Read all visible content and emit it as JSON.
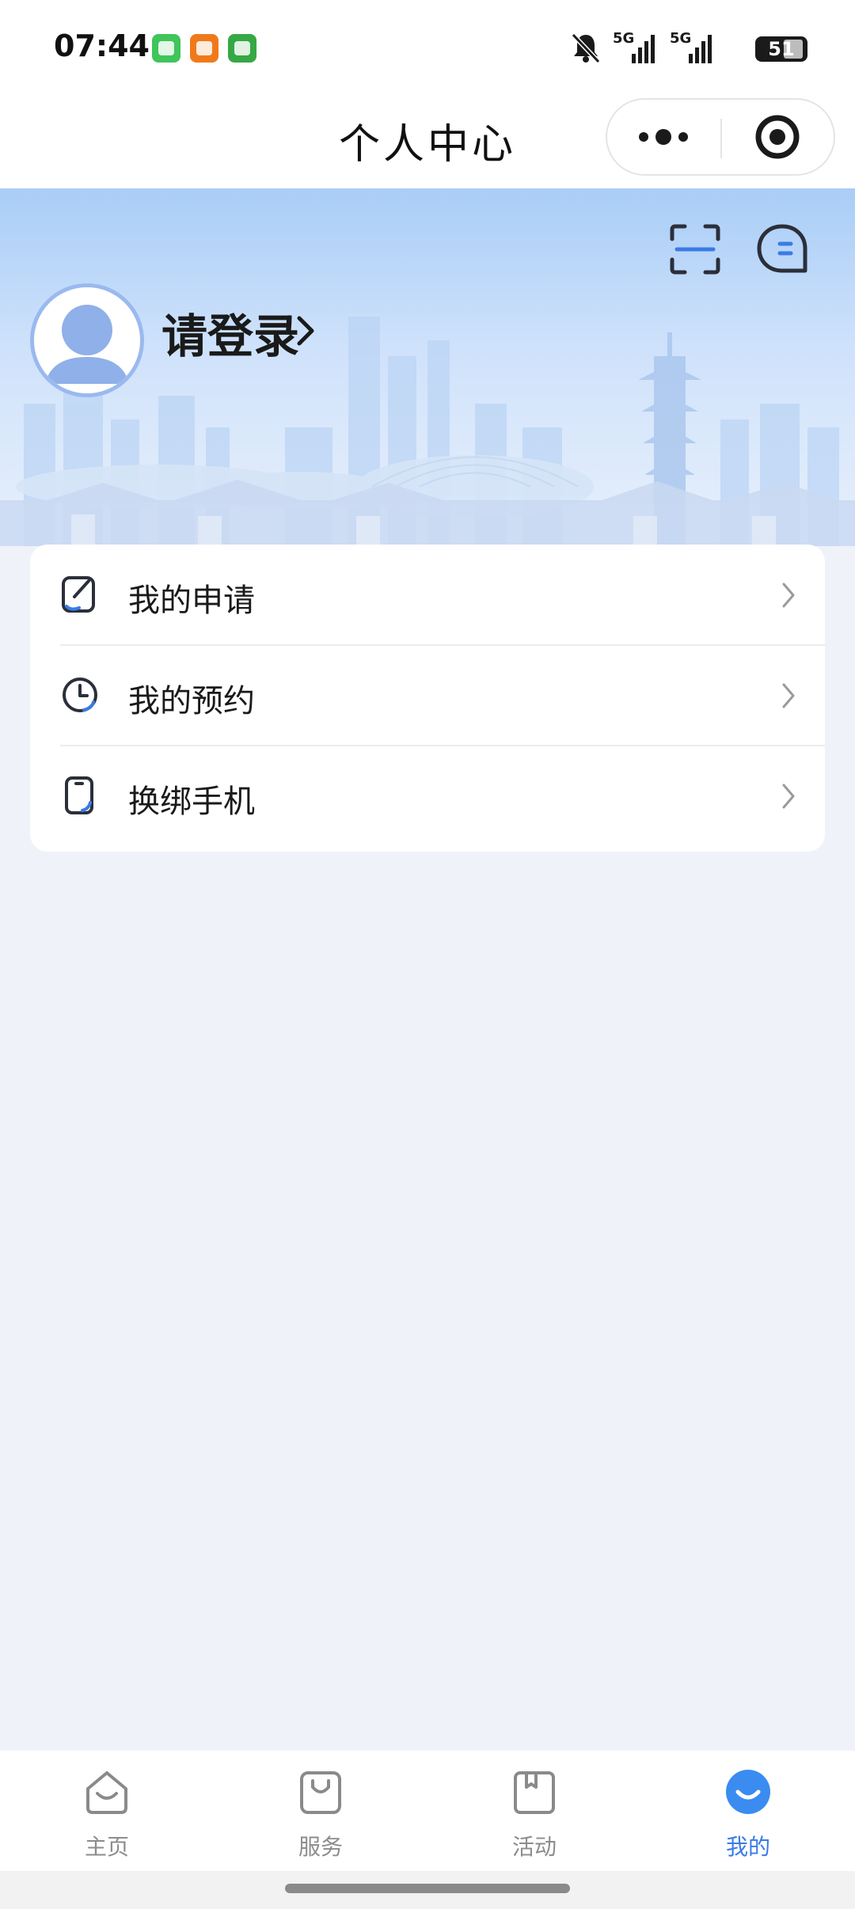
{
  "status_bar": {
    "time": "07:44",
    "network_1": "5G",
    "network_2": "5G",
    "battery": "51"
  },
  "header": {
    "title": "个人中心"
  },
  "profile": {
    "login_label": "请登录"
  },
  "menu": [
    {
      "label": "我的申请",
      "icon": "edit-note-icon"
    },
    {
      "label": "我的预约",
      "icon": "clock-icon"
    },
    {
      "label": "换绑手机",
      "icon": "phone-icon"
    }
  ],
  "tabs": [
    {
      "label": "主页",
      "icon": "home-icon",
      "active": false
    },
    {
      "label": "服务",
      "icon": "shopping-bag-icon",
      "active": false
    },
    {
      "label": "活动",
      "icon": "bookmark-icon",
      "active": false
    },
    {
      "label": "我的",
      "icon": "profile-icon",
      "active": true
    }
  ],
  "colors": {
    "accent": "#3a7be6",
    "page_background": "#eff3f9",
    "hero_top": "#a9cdf7"
  }
}
